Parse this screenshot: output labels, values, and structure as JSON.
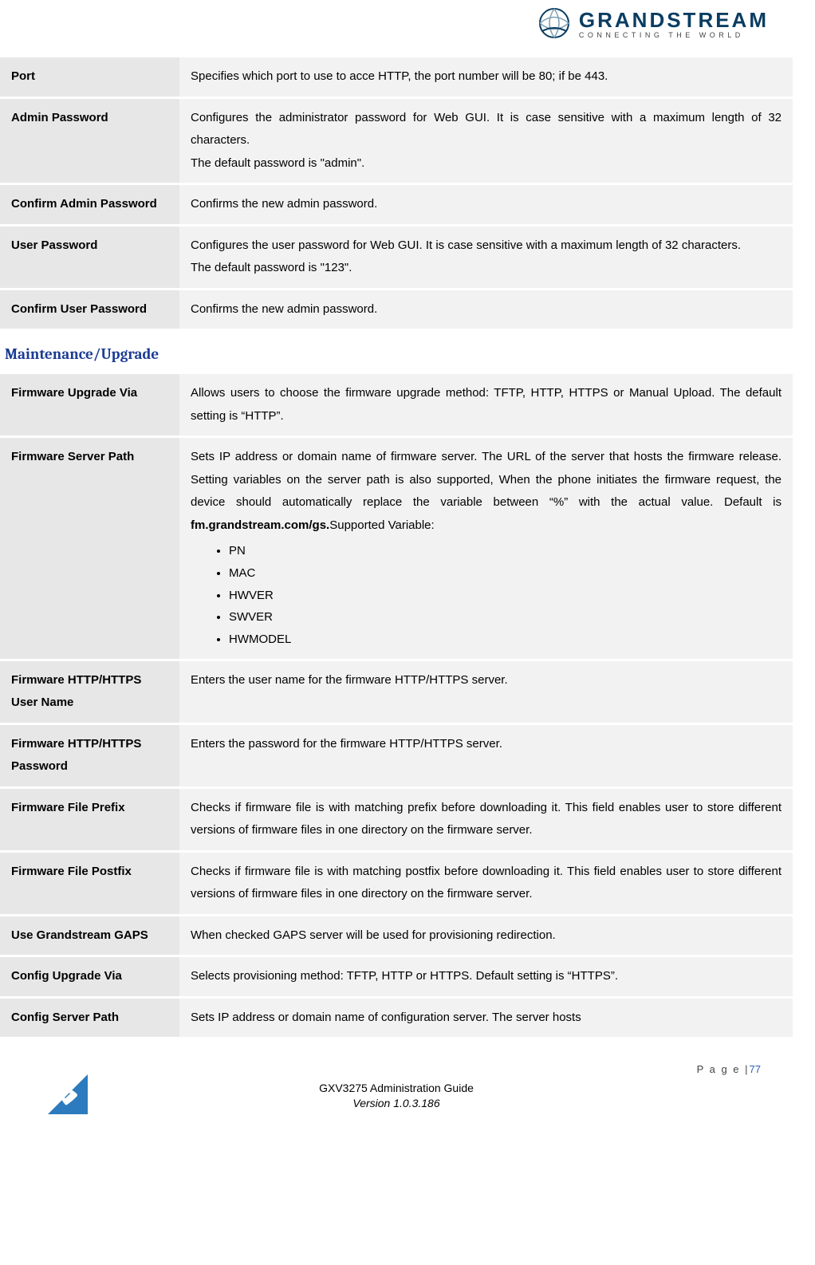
{
  "logo": {
    "brand": "GRANDSTREAM",
    "tagline": "CONNECTING THE WORLD"
  },
  "table1": [
    {
      "label": "Port",
      "desc": "Specifies which port to use to acce HTTP, the port number will be 80; if be 443."
    },
    {
      "label": "Admin Password",
      "desc": "Configures the administrator password for Web GUI. It is case sensitive with a maximum length of 32 characters.\nThe default password is \"admin\"."
    },
    {
      "label": "Confirm Admin Password",
      "desc": "Confirms the new admin password."
    },
    {
      "label": "User Password",
      "desc": "Configures the user password for Web GUI. It is case sensitive with a maximum length of 32 characters.\nThe default password is \"123\"."
    },
    {
      "label": "Confirm User Password",
      "desc": "Confirms the new admin password."
    }
  ],
  "section_heading": "Maintenance/Upgrade",
  "table2": [
    {
      "label": "Firmware Upgrade Via",
      "desc": "Allows users to choose the firmware upgrade method: TFTP, HTTP, HTTPS or Manual Upload. The default setting is “HTTP”."
    },
    {
      "label": "Firmware Server Path",
      "desc_pre": "Sets IP address or domain name of firmware server. The URL of the server that hosts the firmware release. Setting variables on the server path is also supported, When the phone initiates the firmware request, the device should automatically replace the variable between “%” with the actual value. Default is ",
      "desc_bold": "fm.grandstream.com/gs.",
      "desc_post": "Supported Variable:",
      "bullets": [
        "PN",
        "MAC",
        "HWVER",
        "SWVER",
        "HWMODEL"
      ]
    },
    {
      "label": "Firmware HTTP/HTTPS User Name",
      "desc": "Enters the user name for the firmware HTTP/HTTPS server."
    },
    {
      "label": "Firmware HTTP/HTTPS Password",
      "desc": "Enters the password for the firmware HTTP/HTTPS server."
    },
    {
      "label": "Firmware File Prefix",
      "desc": "Checks if firmware file is with matching prefix before downloading it. This field enables user to store different versions of firmware files in one directory on the firmware server."
    },
    {
      "label": "Firmware File Postfix",
      "desc": "Checks if firmware file is with matching postfix before downloading it. This field enables user to store different versions of firmware files in one directory on the firmware server."
    },
    {
      "label": "Use Grandstream GAPS",
      "desc": "When checked GAPS server will be used for provisioning redirection."
    },
    {
      "label": "Config Upgrade Via",
      "desc": "Selects provisioning method: TFTP, HTTP or HTTPS. Default setting is “HTTPS”."
    },
    {
      "label": "Config Server Path",
      "desc": "Sets IP address or domain name of configuration server. The server hosts"
    }
  ],
  "footer": {
    "page_label": "P a g e  |",
    "page_num": "77",
    "title": "GXV3275 Administration Guide",
    "version": "Version 1.0.3.186"
  }
}
